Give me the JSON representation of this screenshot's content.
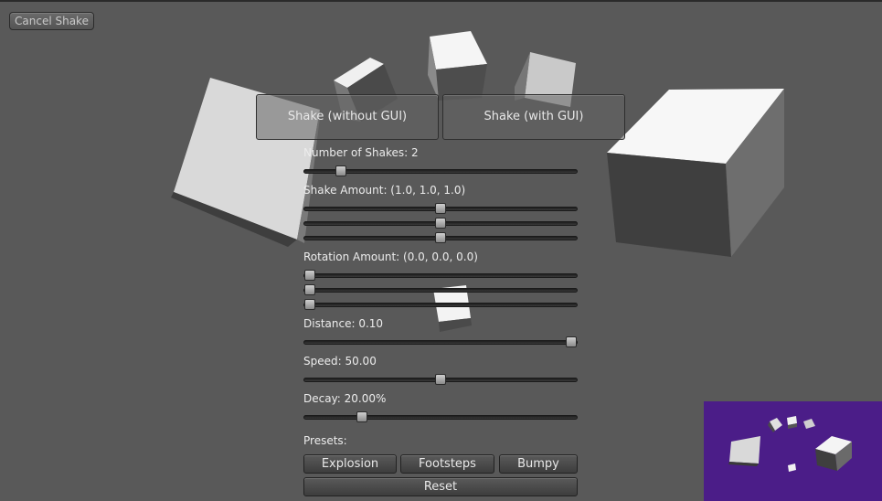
{
  "cancel_label": "Cancel Shake",
  "shake_buttons": {
    "without_gui": "Shake (without GUI)",
    "with_gui": "Shake (with GUI)"
  },
  "controls": {
    "number_of_shakes": {
      "label": "Number of Shakes: 2",
      "values": [
        0.12
      ]
    },
    "shake_amount": {
      "label": "Shake Amount: (1.0, 1.0, 1.0)",
      "values": [
        0.5,
        0.5,
        0.5
      ]
    },
    "rotation_amount": {
      "label": "Rotation Amount: (0.0, 0.0, 0.0)",
      "values": [
        0.0,
        0.0,
        0.0
      ]
    },
    "distance": {
      "label": "Distance: 0.10",
      "values": [
        1.0
      ]
    },
    "speed": {
      "label": "Speed: 50.00",
      "values": [
        0.5
      ]
    },
    "decay": {
      "label": "Decay: 20.00%",
      "values": [
        0.2
      ]
    }
  },
  "presets": {
    "label": "Presets:",
    "explosion": "Explosion",
    "footsteps": "Footsteps",
    "bumpy": "Bumpy",
    "reset": "Reset"
  },
  "colors": {
    "background": "#595959",
    "minimap_background": "#4b1d88"
  }
}
